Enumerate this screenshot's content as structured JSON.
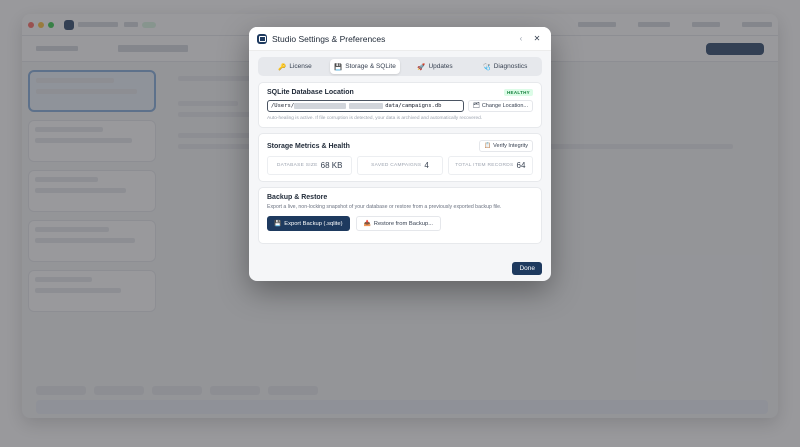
{
  "modal": {
    "title": "Studio Settings & Preferences",
    "tabs": [
      {
        "icon": "🔑",
        "label": "License"
      },
      {
        "icon": "💾",
        "label": "Storage & SQLite"
      },
      {
        "icon": "🚀",
        "label": "Updates"
      },
      {
        "icon": "🩺",
        "label": "Diagnostics"
      }
    ],
    "active_tab": "Storage & SQLite",
    "db_location": {
      "title": "SQLite Database Location",
      "status_badge": "HEALTHY",
      "path_prefix": "/Users/",
      "path_suffix": "data/campaigns.db",
      "change_button": "Change Location...",
      "hint": "Auto-healing is active. If file corruption is detected, your data is archived and automatically recovered."
    },
    "metrics": {
      "title": "Storage Metrics & Health",
      "verify_button": "Verify Integrity",
      "items": [
        {
          "label": "DATABASE SIZE",
          "value": "68 KB"
        },
        {
          "label": "SAVED CAMPAIGNS",
          "value": "4"
        },
        {
          "label": "TOTAL ITEM RECORDS",
          "value": "64"
        }
      ]
    },
    "backup": {
      "title": "Backup & Restore",
      "description": "Export a live, non-locking snapshot of your database or restore from a previously exported backup file.",
      "export_button": "Export Backup (.sqlite)",
      "restore_button": "Restore from Backup..."
    },
    "done_button": "Done"
  },
  "colors": {
    "primary": "#1e3a5f",
    "healthy_bg": "#dcfce7",
    "healthy_text": "#15803d",
    "overlay": "#46464b"
  }
}
